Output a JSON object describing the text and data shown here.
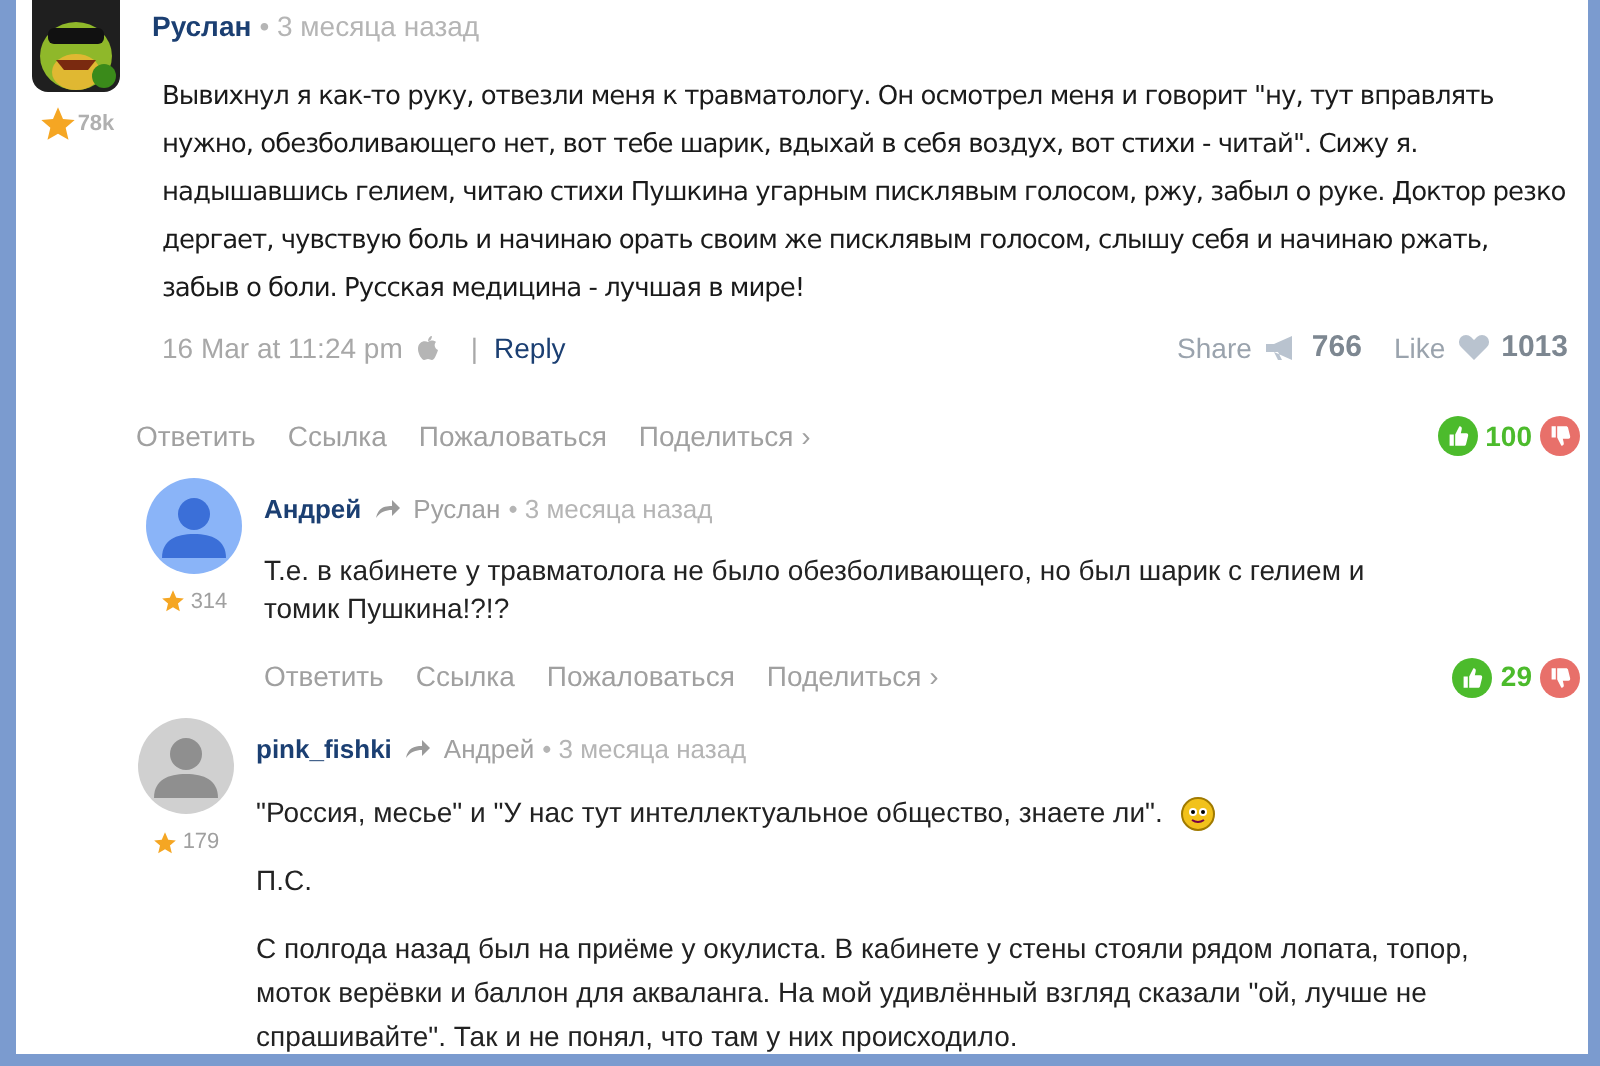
{
  "post": {
    "author": "Руслан",
    "time": "• 3 месяца назад",
    "rating": "78k",
    "text": "Вывихнул я как-то руку, отвезли меня к травматологу. Он осмотрел меня и говорит \"ну, тут вправлять нужно, обезболивающего нет, вот тебе шарик, вдыхай в себя воздух, вот стихи - читай\". Сижу я. надышавшись гелием, читаю стихи Пушкина угарным писклявым голосом, ржу, забыл о руке. Доктор резко дергает, чувствую боль и начинаю орать своим же писклявым голосом, слышу себя и начинаю ржать, забыв о боли. Русская медицина - лучшая в мире!",
    "date": "16 Mar at 11:24 pm",
    "separator": "|",
    "reply": "Reply",
    "share_label": "Share",
    "share_count": "766",
    "like_label": "Like",
    "like_count": "1013",
    "actions": [
      "Ответить",
      "Ссылка",
      "Пожаловаться",
      "Поделиться ›"
    ],
    "score": "100"
  },
  "replies": [
    {
      "author": "Андрей",
      "reply_to": "Руслан",
      "time": "• 3 месяца назад",
      "rating": "314",
      "kind": "blue",
      "paragraphs": [
        {
          "text": "Т.е. в кабинете у травматолога не было обезболивающего, но был шарик с гелием и томик Пушкина!?!?",
          "smiley": false
        }
      ],
      "actions": [
        "Ответить",
        "Ссылка",
        "Пожаловаться",
        "Поделиться ›"
      ],
      "score": "29"
    },
    {
      "author": "pink_fishki",
      "reply_to": "Андрей",
      "time": "• 3 месяца назад",
      "rating": "179",
      "kind": "gray",
      "paragraphs": [
        {
          "text": "\"Россия, месье\" и \"У нас тут интеллектуальное общество, знаете ли\".",
          "smiley": true
        },
        {
          "text": "П.С.",
          "smiley": false
        },
        {
          "text": "С полгода назад был на приёме у окулиста. В кабинете у стены стояли рядом лопата, топор, моток верёвки и баллон для акваланга. На мой удивлённый взгляд сказали \"ой, лучше не спрашивайте\". Так и не понял, что там у них происходило.",
          "smiley": false
        }
      ]
    }
  ]
}
